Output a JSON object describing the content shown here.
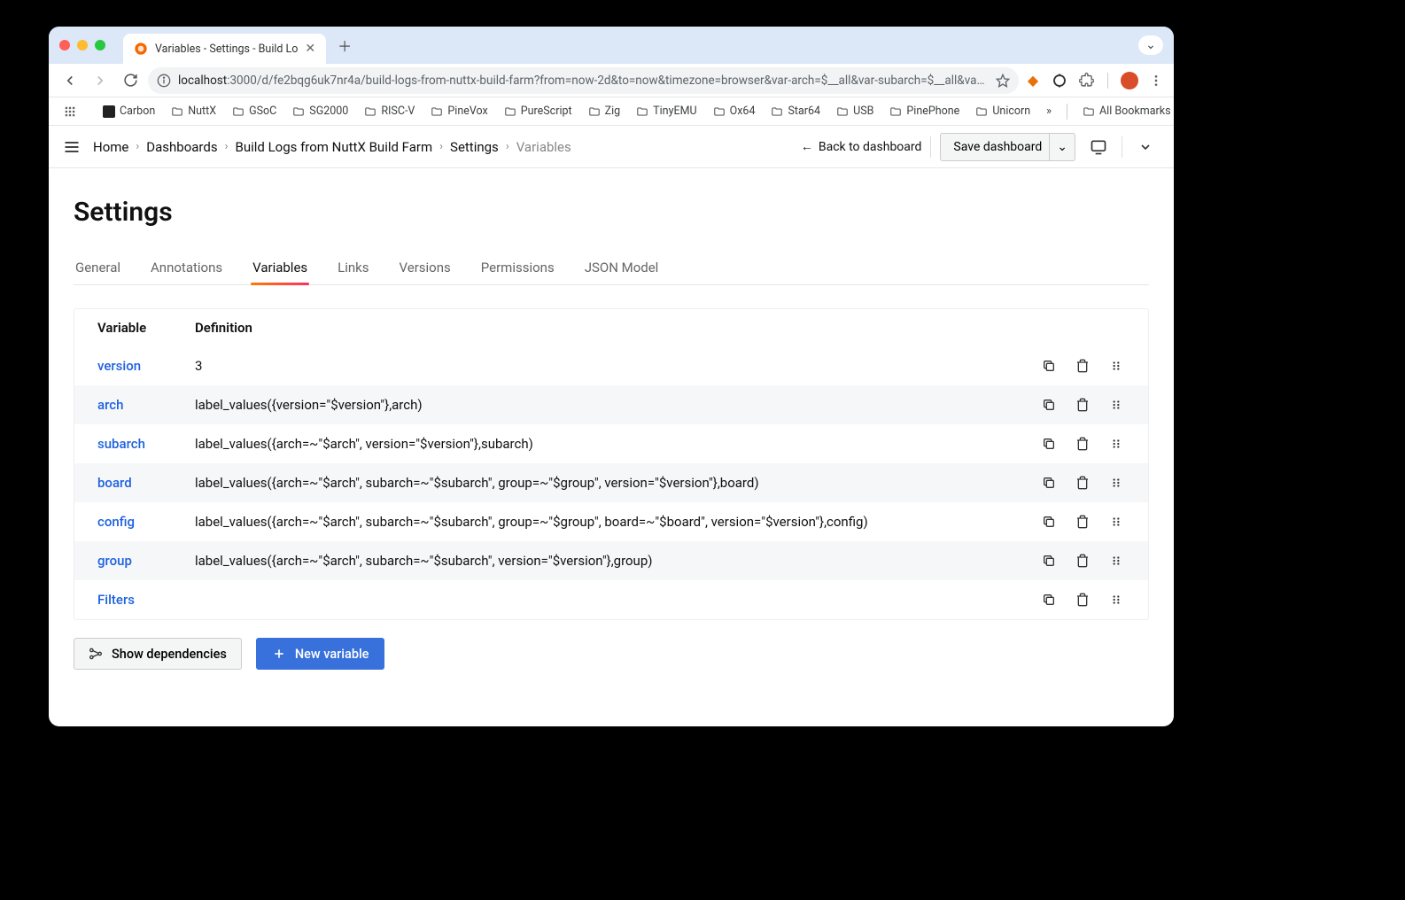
{
  "browser": {
    "tab_title": "Variables - Settings - Build Lo",
    "url_host": "localhost",
    "url_path": ":3000/d/fe2bqg6uk7nr4a/build-logs-from-nuttx-build-farm?from=now-2d&to=now&timezone=browser&var-arch=$__all&var-subarch=$__all&var-bo...",
    "bookmarks": [
      "Carbon",
      "NuttX",
      "GSoC",
      "SG2000",
      "RISC-V",
      "PineVox",
      "PureScript",
      "Zig",
      "TinyEMU",
      "Ox64",
      "Star64",
      "USB",
      "PinePhone",
      "Unicorn"
    ],
    "all_bookmarks": "All Bookmarks"
  },
  "header": {
    "breadcrumb": [
      "Home",
      "Dashboards",
      "Build Logs from NuttX Build Farm",
      "Settings",
      "Variables"
    ],
    "back": "Back to dashboard",
    "save": "Save dashboard"
  },
  "page": {
    "title": "Settings",
    "tabs": [
      "General",
      "Annotations",
      "Variables",
      "Links",
      "Versions",
      "Permissions",
      "JSON Model"
    ],
    "active_tab": 2,
    "table": {
      "col_variable": "Variable",
      "col_definition": "Definition"
    },
    "variables": [
      {
        "name": "version",
        "definition": "3"
      },
      {
        "name": "arch",
        "definition": "label_values({version=\"$version\"},arch)"
      },
      {
        "name": "subarch",
        "definition": "label_values({arch=~\"$arch\", version=\"$version\"},subarch)"
      },
      {
        "name": "board",
        "definition": "label_values({arch=~\"$arch\", subarch=~\"$subarch\", group=~\"$group\", version=\"$version\"},board)"
      },
      {
        "name": "config",
        "definition": "label_values({arch=~\"$arch\", subarch=~\"$subarch\", group=~\"$group\", board=~\"$board\", version=\"$version\"},config)"
      },
      {
        "name": "group",
        "definition": "label_values({arch=~\"$arch\", subarch=~\"$subarch\", version=\"$version\"},group)"
      },
      {
        "name": "Filters",
        "definition": ""
      }
    ],
    "show_deps": "Show dependencies",
    "new_var": "New variable"
  }
}
